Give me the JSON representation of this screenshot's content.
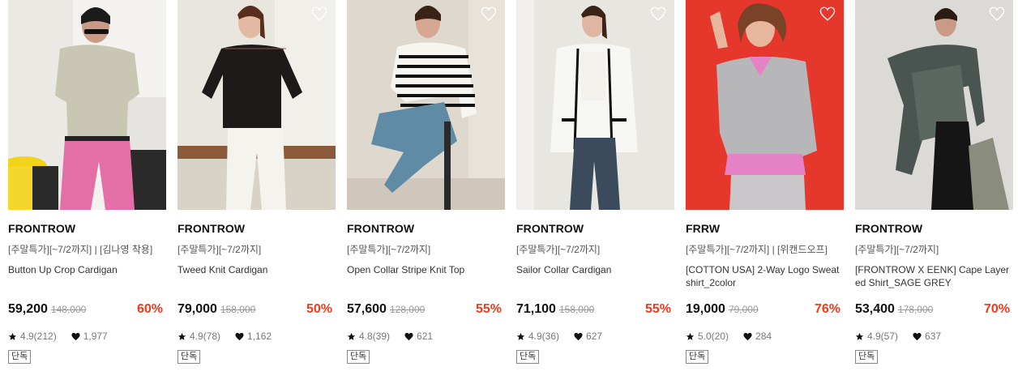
{
  "products": [
    {
      "brand": "FRONTROW",
      "promo": "[주말특가][~7/2까지] | [김나영 착용]",
      "name": "Button Up Crop Cardigan",
      "price": "59,200",
      "original_price": "148,000",
      "discount": "60%",
      "rating": "4.9(212)",
      "likes": "1,977",
      "badge": "단독",
      "wishlisted": false
    },
    {
      "brand": "FRONTROW",
      "promo": "[주말특가][~7/2까지]",
      "name": "Tweed Knit Cardigan",
      "price": "79,000",
      "original_price": "158,000",
      "discount": "50%",
      "rating": "4.9(78)",
      "likes": "1,162",
      "badge": "단독",
      "wishlisted": false
    },
    {
      "brand": "FRONTROW",
      "promo": "[주말특가][~7/2까지]",
      "name": "Open Collar Stripe Knit Top",
      "price": "57,600",
      "original_price": "128,000",
      "discount": "55%",
      "rating": "4.8(39)",
      "likes": "621",
      "badge": "단독",
      "wishlisted": false
    },
    {
      "brand": "FRONTROW",
      "promo": "[주말특가][~7/2까지]",
      "name": "Sailor Collar Cardigan",
      "price": "71,100",
      "original_price": "158,000",
      "discount": "55%",
      "rating": "4.9(36)",
      "likes": "627",
      "badge": "단독",
      "wishlisted": false
    },
    {
      "brand": "FRRW",
      "promo": "[주말특가][~7/2까지] | [위캔드오프]",
      "name": "[COTTON USA] 2-Way Logo Sweat shirt_2color",
      "price": "19,000",
      "original_price": "79,000",
      "discount": "76%",
      "rating": "5.0(20)",
      "likes": "284",
      "badge": "단독",
      "wishlisted": false
    },
    {
      "brand": "FRONTROW",
      "promo": "[주말특가][~7/2까지]",
      "name": "[FRONTROW X EENK] Cape Layered Shirt_SAGE GREY",
      "price": "53,400",
      "original_price": "178,000",
      "discount": "70%",
      "rating": "4.9(57)",
      "likes": "637",
      "badge": "단독",
      "wishlisted": false
    }
  ],
  "colors": {
    "discount": "#ef3b1b",
    "text": "#111111",
    "muted": "#777777"
  },
  "icons": {
    "wishlist": "heart-outline-icon",
    "rating": "star-icon",
    "likes": "heart-filled-icon"
  }
}
